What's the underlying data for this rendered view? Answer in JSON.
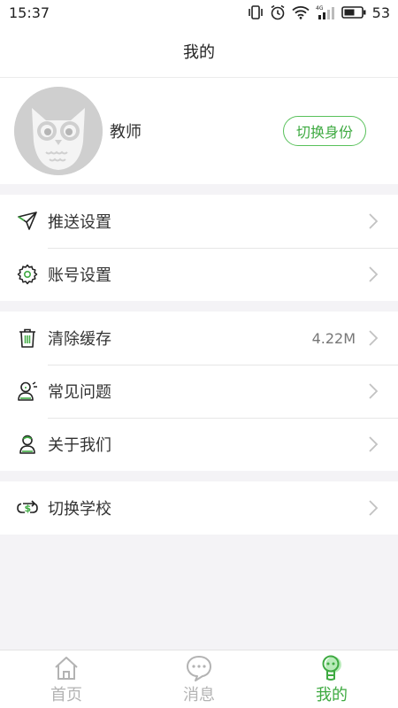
{
  "status": {
    "time": "15:37",
    "battery": "53",
    "net": "4G"
  },
  "header": {
    "title": "我的"
  },
  "profile": {
    "role": "教师",
    "switch_label": "切换身份"
  },
  "groups": [
    [
      {
        "icon": "paper-plane-icon",
        "label": "推送设置"
      },
      {
        "icon": "gear-icon",
        "label": "账号设置"
      }
    ],
    [
      {
        "icon": "trash-icon",
        "label": "清除缓存",
        "value": "4.22M"
      },
      {
        "icon": "faq-person-icon",
        "label": "常见问题"
      },
      {
        "icon": "about-person-icon",
        "label": "关于我们"
      }
    ],
    [
      {
        "icon": "switch-school-icon",
        "label": "切换学校"
      }
    ]
  ],
  "tabs": [
    {
      "icon": "home-icon",
      "label": "首页",
      "active": false
    },
    {
      "icon": "message-icon",
      "label": "消息",
      "active": false
    },
    {
      "icon": "me-icon",
      "label": "我的",
      "active": true
    }
  ],
  "colors": {
    "accent": "#3eaa41",
    "background": "#f4f3f6"
  }
}
